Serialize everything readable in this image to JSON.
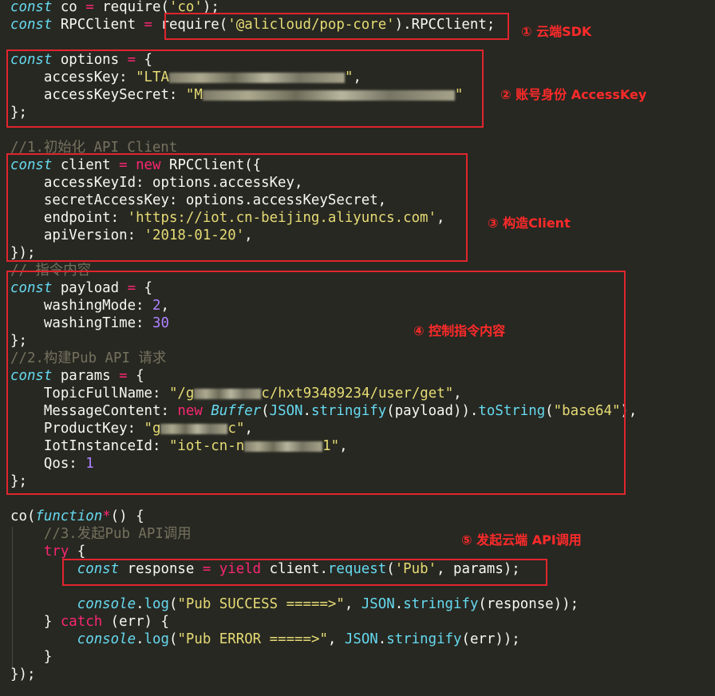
{
  "code": {
    "l1": {
      "kw": "const",
      "name": " co ",
      "eq": "=",
      "rest_a": " require(",
      "str": "'co'",
      "rest_b": ");"
    },
    "l2": {
      "kw": "const",
      "name": " RPCClient ",
      "eq": "=",
      "rest_a": " require(",
      "str": "'@alicloud/pop-core'",
      "rest_b": ").RPCClient;"
    },
    "l3": {
      "kw": "const",
      "name": " options ",
      "eq": "=",
      "rest": " {"
    },
    "l4": {
      "key": "    accessKey: ",
      "str_open": "\"LTA",
      "str_close": "\"",
      "tail": ","
    },
    "l5": {
      "key": "    accessKeySecret: ",
      "str_open": "\"M",
      "str_close": "\""
    },
    "l6": {
      "text": "};"
    },
    "l7": {
      "comment": "//1.初始化 API Client"
    },
    "l8": {
      "kw": "const",
      "name": " client ",
      "eq": "=",
      "new": " new",
      "rest": " RPCClient({"
    },
    "l9": {
      "text": "    accessKeyId: options.accessKey,"
    },
    "l10": {
      "text": "    secretAccessKey: options.accessKeySecret,"
    },
    "l11": {
      "key": "    endpoint: ",
      "str": "'https://iot.cn-beijing.aliyuncs.com'",
      "tail": ","
    },
    "l12": {
      "key": "    apiVersion: ",
      "str": "'2018-01-20'",
      "tail": ","
    },
    "l13": {
      "text": "});"
    },
    "l14": {
      "comment": "// 指令内容"
    },
    "l15": {
      "kw": "const",
      "name": " payload ",
      "eq": "=",
      "rest": " {"
    },
    "l16": {
      "key": "    washingMode: ",
      "num": "2",
      "tail": ","
    },
    "l17": {
      "key": "    washingTime: ",
      "num": "30"
    },
    "l18": {
      "text": "};"
    },
    "l19": {
      "comment": "//2.构建Pub API 请求"
    },
    "l20": {
      "kw": "const",
      "name": " params ",
      "eq": "=",
      "rest": " {"
    },
    "l21": {
      "key": "    TopicFullName: ",
      "str_open": "\"/g",
      "str_close": "c/hxt93489234/user/get\"",
      "tail": ","
    },
    "l22": {
      "key": "    MessageContent: ",
      "new": "new",
      "sp": " ",
      "cls": "Buffer",
      "p1": "(",
      "json": "JSON",
      "dot1": ".",
      "fn1": "stringify",
      "p2": "(payload)).",
      "fn2": "toString",
      "p3": "(",
      "str": "\"base64\"",
      "p4": "),"
    },
    "l23": {
      "key": "    ProductKey: ",
      "str_open": "\"g",
      "str_close": "c\"",
      "tail": ","
    },
    "l24": {
      "key": "    IotInstanceId: ",
      "str_open": "\"iot-cn-n",
      "str_close": "1\"",
      "tail": ","
    },
    "l25": {
      "key": "    Qos: ",
      "num": "1"
    },
    "l26": {
      "text": "};"
    },
    "l27": {
      "a": "co(",
      "fn": "function",
      "star": "*",
      "b": "() {"
    },
    "l28": {
      "comment": "    //3.发起Pub API调用"
    },
    "l29": {
      "indent": "    ",
      "kw": "try",
      "rest": " {"
    },
    "l30": {
      "indent": "        ",
      "kw": "const",
      "name": " response ",
      "eq": "=",
      "sp": " ",
      "yield": "yield",
      "a": " client.",
      "fn": "request",
      "b": "(",
      "str": "'Pub'",
      "c": ", params);"
    },
    "l31": {
      "indent": "        ",
      "obj": "console",
      "dot": ".",
      "fn": "log",
      "a": "(",
      "str": "\"Pub SUCCESS =====>\"",
      "b": ", ",
      "json": "JSON",
      "dot2": ".",
      "fn2": "stringify",
      "c": "(response));"
    },
    "l32": {
      "a": "    } ",
      "kw": "catch",
      "b": " (err) {"
    },
    "l33": {
      "indent": "        ",
      "obj": "console",
      "dot": ".",
      "fn": "log",
      "a": "(",
      "str": "\"Pub ERROR =====>\"",
      "b": ", ",
      "json": "JSON",
      "dot2": ".",
      "fn2": "stringify",
      "c": "(err));"
    },
    "l34": {
      "text": "    }"
    },
    "l35": {
      "text": "});"
    }
  },
  "annotations": {
    "a1": "① 云端SDK",
    "a2": "② 账号身份 AccessKey",
    "a3": "③ 构造Client",
    "a4": "④ 控制指令内容",
    "a5": "⑤ 发起云端 API调用"
  },
  "colors": {
    "background": "#272822",
    "keyword": "#66d9ef",
    "operator": "#f92672",
    "string": "#e6db74",
    "comment": "#75715e",
    "number": "#ae81ff",
    "function": "#a6e22e",
    "annotation": "#ff2a2a"
  }
}
